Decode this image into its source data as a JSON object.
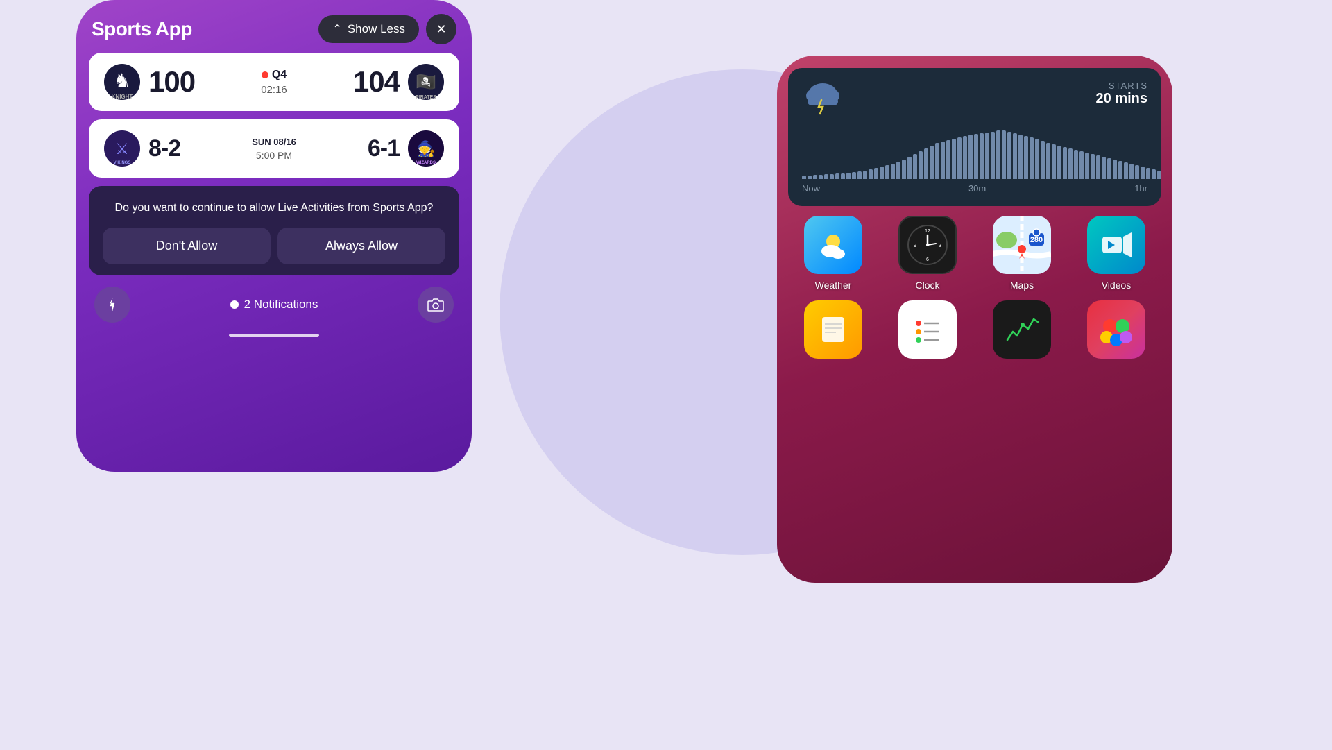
{
  "background": {
    "color": "#e8e4f5"
  },
  "phone_left": {
    "title": "Sports App",
    "show_less_label": "Show Less",
    "close_label": "×",
    "game1": {
      "team1_name": "Knight",
      "team1_score": "100",
      "quarter": "Q4",
      "time": "02:16",
      "team2_score": "104",
      "team2_name": "Pirates",
      "is_live": true
    },
    "game2": {
      "team1_name": "Vikings",
      "team1_score": "8-2",
      "date": "SUN 08/16",
      "time": "5:00 PM",
      "team2_score": "6-1",
      "team2_name": "Wizards"
    },
    "permission": {
      "question": "Do you want to continue to allow Live Activities from Sports App?",
      "dont_allow": "Don't Allow",
      "always_allow": "Always Allow"
    },
    "notifications": {
      "count": "2",
      "label": "2 Notifications"
    }
  },
  "phone_right": {
    "weather_widget": {
      "starts_label": "STARTS",
      "starts_time": "20 mins",
      "now_label": "Now",
      "thirty_min_label": "30m",
      "one_hr_label": "1hr"
    },
    "apps_row1": [
      {
        "name": "Weather",
        "type": "weather"
      },
      {
        "name": "Clock",
        "type": "clock"
      },
      {
        "name": "Maps",
        "type": "maps"
      },
      {
        "name": "Videos",
        "type": "videos"
      }
    ],
    "apps_row2": [
      {
        "name": "",
        "type": "notes-yellow"
      },
      {
        "name": "",
        "type": "notes-white"
      },
      {
        "name": "",
        "type": "stocks"
      },
      {
        "name": "",
        "type": "game-center"
      }
    ]
  }
}
